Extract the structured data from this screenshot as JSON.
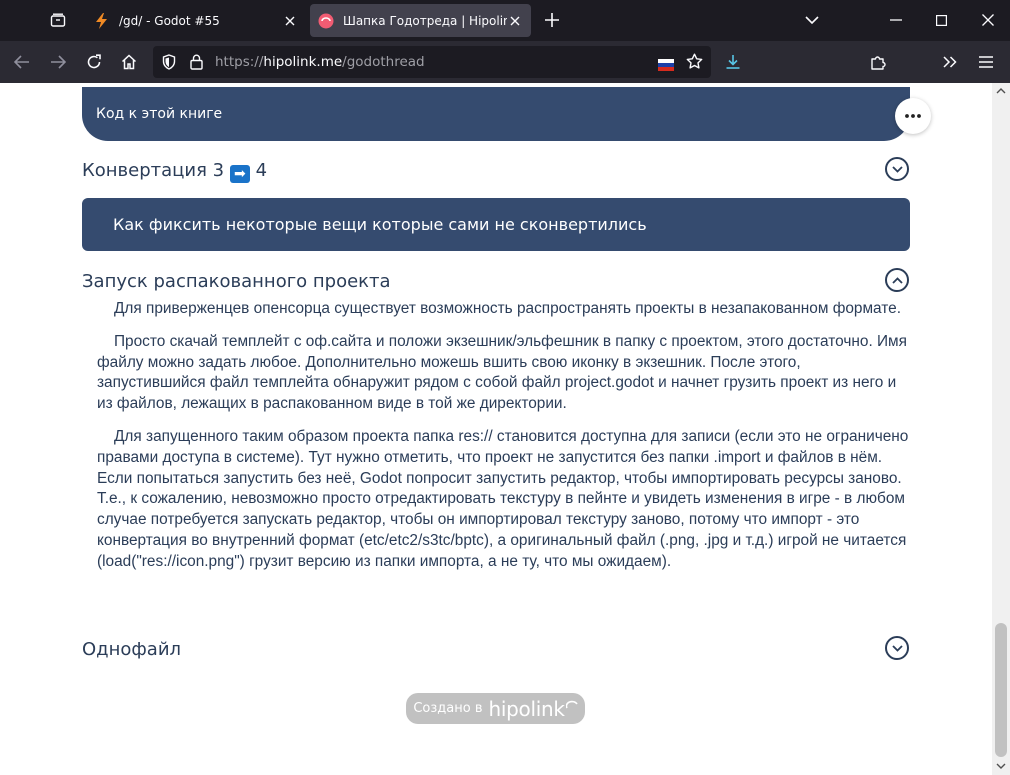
{
  "browser": {
    "tabs": [
      {
        "title": "/gd/ - Godot #55",
        "active": false
      },
      {
        "title": "Шапка Годотреда | Hipolink",
        "active": true
      }
    ],
    "url_prefix": "https://",
    "url_host": "hipolink.me",
    "url_path": "/godothread"
  },
  "page": {
    "top_link": "Код к этой книге",
    "sections": [
      {
        "title": "Конвертация 3",
        "title_tail": "4",
        "expanded": false
      },
      {
        "title": "Запуск распакованного проекта",
        "expanded": true
      },
      {
        "title": "Однофайл",
        "expanded": false
      }
    ],
    "convert_link": "Как фиксить некоторые вещи которые сами не сконвертились",
    "arrow_glyph": "➡",
    "paragraphs": [
      "Для приверженцев опенсорца существует возможность распространять проекты в незапакованном формате.",
      "Просто скачай темплейт с оф.сайта и положи экзешник/эльфешник в папку с проектом, этого достаточно. Имя файлу можно задать любое. Дополнительно можешь вшить свою иконку в экзешник. После этого, запустившийся файл темплейта обнаружит рядом с собой файл project.godot и начнет грузить проект из него и из файлов, лежащих в распакованном виде в той же директории.",
      "Для запущенного таким образом проекта папка res:// становится доступна для записи (если это не ограничено правами доступа в системе). Тут нужно отметить, что проект не запустится без папки .import и файлов в нём. Если попытаться запустить без неё, Godot попросит запустить редактор, чтобы импортировать ресурсы заново. Т.е., к сожалению, невозможно просто отредактировать текстуру в пейнте и увидеть изменения в игре - в любом случае потребуется запускать редактор, чтобы он импортировал текстуру заново, потому что импорт - это конвертация во внутренний формат (etc/etc2/s3tc/bptc), а оригинальный файл (.png, .jpg и т.д.) игрой не читается (load(\"res://icon.png\") грузит версию из папки импорта, а не ту, что мы ожидаем)."
    ],
    "footer_made": "Создано в",
    "footer_brand": "hipolink"
  },
  "colors": {
    "accent": "#354b6f",
    "text": "#2b3d58",
    "badge": "#c1c1c1"
  }
}
